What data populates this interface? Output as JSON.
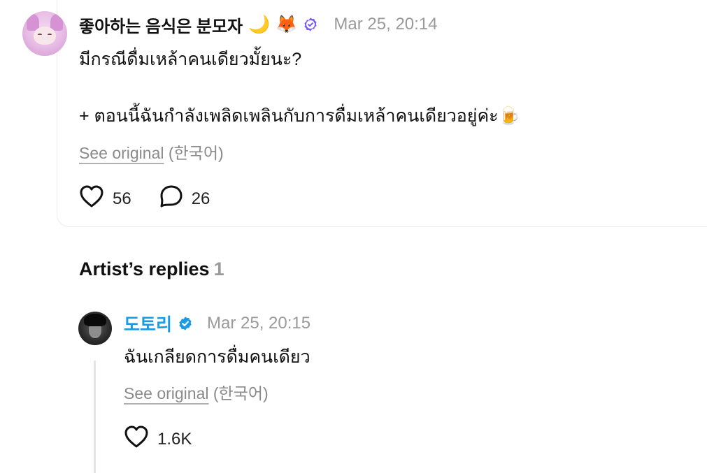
{
  "comment": {
    "author": "좋아하는 음식은 분모자",
    "emoji_moon": "🌙",
    "emoji_fox": "🦊",
    "timestamp": "Mar 25, 20:14",
    "line1": "มีกรณีดื่มเหล้าคนเดียวมั้ยนะ?",
    "line2": "+ ตอนนี้ฉันกำลังเพลิดเพลินกับการดื่มเหล้าคนเดียวอยู่ค่ะ🍺",
    "see_original": "See original",
    "original_lang": "(한국어)",
    "likes": "56",
    "replies": "26"
  },
  "artist_replies": {
    "title": "Artist’s replies",
    "count": "1"
  },
  "reply": {
    "author": "도토리",
    "timestamp": "Mar 25, 20:15",
    "text": "ฉันเกลียดการดื่มคนเดียว",
    "see_original": "See original",
    "original_lang": "(한국어)",
    "likes": "1.6K"
  },
  "colors": {
    "artist_name": "#1a9be6",
    "verified_artist": "#1a9be6",
    "verified_fan": "#7b5cf0",
    "muted": "#9a9a9a"
  },
  "icons": [
    "heart-icon",
    "comment-icon",
    "verified-icon"
  ]
}
